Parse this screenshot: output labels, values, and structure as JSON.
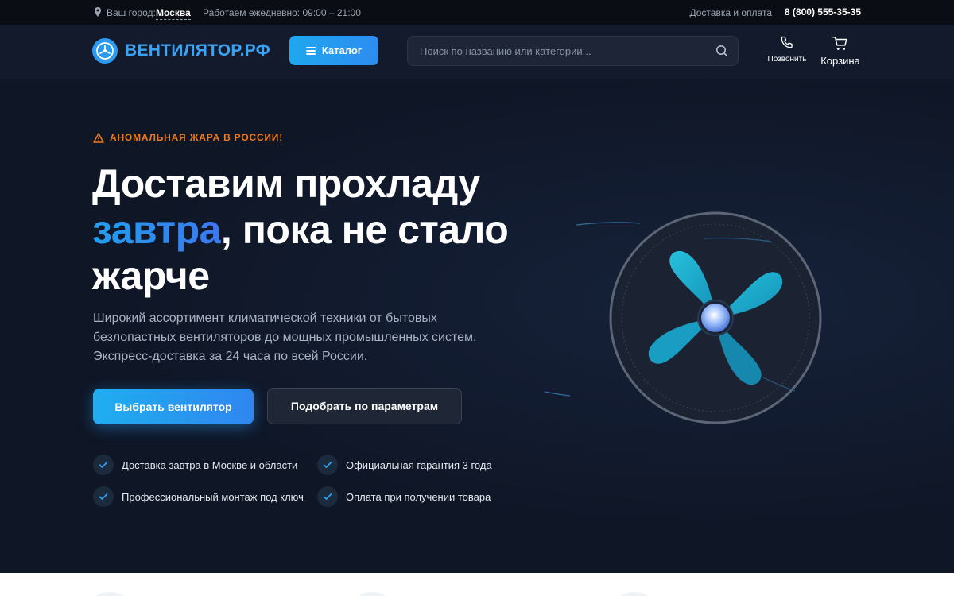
{
  "topbar": {
    "city_label": "Ваш город:",
    "city": "Москва",
    "hours": "Работаем ежедневно: 09:00 – 21:00",
    "delivery_link": "Доставка и оплата",
    "phone": "8 (800) 555-35-35"
  },
  "header": {
    "logo_text": "ВЕНТИЛЯТОР.РФ",
    "catalog_label": "Каталог",
    "search_placeholder": "Поиск по названию или категории...",
    "call_label": "Позвонить",
    "cart_label": "Корзина"
  },
  "hero": {
    "alert": "АНОМАЛЬНАЯ ЖАРА В РОССИИ!",
    "headline_part1": "Доставим прохладу",
    "headline_accent": "завтра",
    "headline_part2": ", пока не стало",
    "headline_part3": "жарче",
    "subtitle": "Широкий ассортимент климатической техники от бытовых безлопастных вентиляторов до мощных промышленных систем. Экспресс-доставка за 24 часа по всей России.",
    "primary_button": "Выбрать вентилятор",
    "secondary_button": "Подобрать по параметрам",
    "features": [
      {
        "label": "Доставка завтра в Москве и области"
      },
      {
        "label": "Официальная гарантия 3 года"
      },
      {
        "label": "Профессиональный монтаж под ключ"
      },
      {
        "label": "Оплата при получении товара"
      }
    ]
  },
  "colors": {
    "accent": "#2b9af3",
    "alert": "#ef7a1a",
    "background": "#0f1626"
  },
  "icons": [
    "location-pin-icon",
    "fan-logo-icon",
    "menu-icon",
    "search-icon",
    "phone-icon",
    "cart-icon",
    "warning-icon",
    "check-icon"
  ]
}
